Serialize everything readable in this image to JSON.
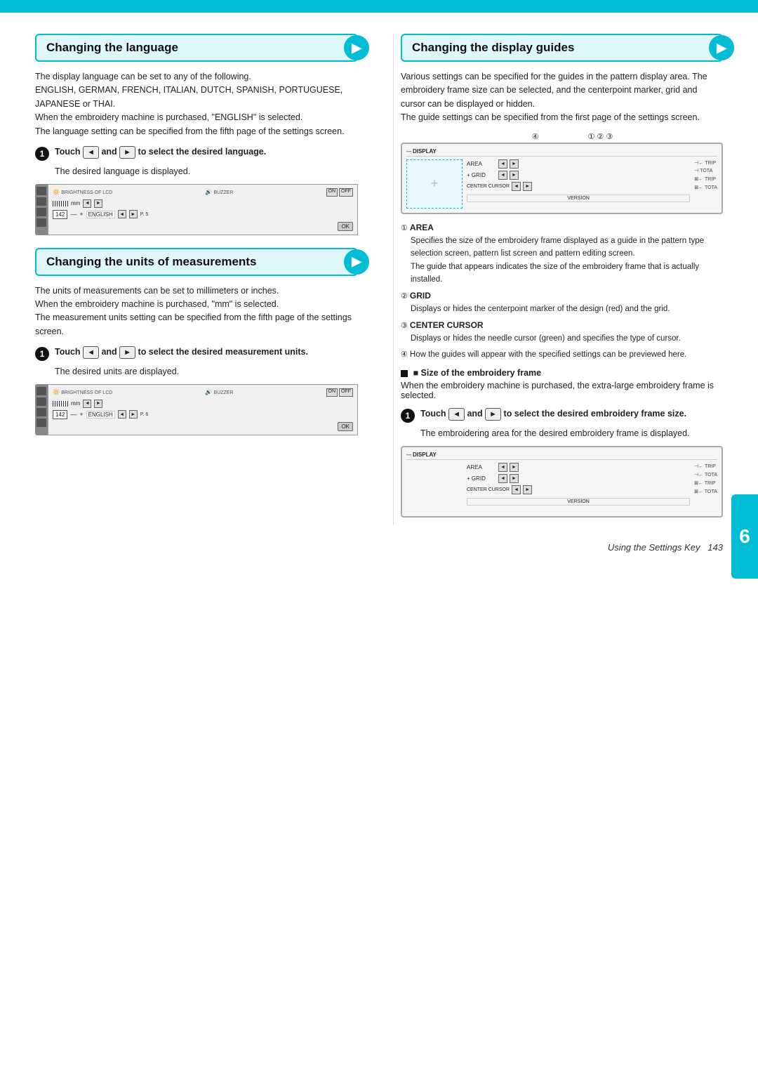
{
  "page": {
    "top_bar_color": "#00bcd4",
    "side_tab_number": "6",
    "footer_text": "Using the Settings Key",
    "footer_page": "143"
  },
  "left_column": {
    "section1": {
      "title": "Changing the language",
      "body_paragraphs": [
        "The display language can be set to any of the following.",
        "ENGLISH, GERMAN, FRENCH, ITALIAN, DUTCH, SPANISH, PORTUGUESE, JAPANESE or THAI.",
        "When the embroidery machine is purchased, \"ENGLISH\" is selected.",
        "The language setting can be specified from the fifth page of the settings screen."
      ],
      "step1": {
        "number": "1",
        "text_before": "Touch",
        "left_arrow": "◄",
        "and_text": "and",
        "right_arrow": "►",
        "text_after": "to select the desired language."
      },
      "result_text": "The desired language is displayed.",
      "screen": {
        "brightness_label": "BRIGHTNESS OF LCD",
        "buzzer_label": "BUZZER",
        "on_label": "ON",
        "off_label": "OFF",
        "mm_label": "mm",
        "num_value": "142",
        "english_label": "ENGLISH",
        "ok_label": "OK",
        "page_indicator": "P. 5"
      }
    },
    "section2": {
      "title": "Changing the units of measurements",
      "body_paragraphs": [
        "The units of measurements can be set to millimeters or inches.",
        "When the embroidery machine is purchased, \"mm\" is selected.",
        "The measurement units setting can be specified from the fifth page of the settings screen."
      ],
      "step1": {
        "number": "1",
        "text_before": "Touch",
        "left_arrow": "◄",
        "and_text": "and",
        "right_arrow": "►",
        "text_after": "to select the desired measurement units."
      },
      "result_text": "The desired units are displayed.",
      "screen": {
        "brightness_label": "BRIGHTNESS OF LCD",
        "buzzer_label": "BUZZER",
        "on_label": "ON",
        "off_label": "OFF",
        "mm_label": "mm",
        "num_value": "142",
        "english_label": "ENGLISH",
        "ok_label": "OK",
        "page_indicator": "P. 6"
      }
    }
  },
  "right_column": {
    "section1": {
      "title": "Changing the display guides",
      "body_paragraphs": [
        "Various settings can be specified for the guides in the pattern display area. The embroidery frame size can be selected, and the centerpoint marker, grid and cursor can be displayed or hidden.",
        "The guide settings can be specified from the first page of the settings screen."
      ],
      "callouts": [
        {
          "num": "①",
          "label": "①"
        },
        {
          "num": "②",
          "label": "②"
        },
        {
          "num": "③",
          "label": "③"
        },
        {
          "num": "④",
          "label": "④"
        }
      ],
      "screen": {
        "display_label": "DISPLAY",
        "area_label": "AREA",
        "grid_label": "+ GRID",
        "center_cursor_label": "CENTER CURSOR",
        "version_label": "VERSION",
        "right_info": [
          "⊣← TRIP",
          "⊣ TOTA",
          "⊠← TRIP",
          "⊠← TOTA"
        ]
      },
      "notes": [
        {
          "number": "①",
          "title": "AREA",
          "text": "Specifies the size of the embroidery frame displayed as a guide in the pattern type selection screen, pattern list screen and pattern editing screen.\nThe guide that appears indicates the size of the embroidery frame that is actually installed."
        },
        {
          "number": "②",
          "title": "GRID",
          "text": "Displays or hides the centerpoint marker of the design (red) and the grid."
        },
        {
          "number": "③",
          "title": "CENTER CURSOR",
          "text": "Displays or hides the needle cursor (green) and specifies the type of cursor."
        },
        {
          "number": "④",
          "text": "How the guides will appear with the specified settings can be previewed here."
        }
      ],
      "size_section": {
        "heading": "■ Size of the embroidery frame",
        "text": "When the embroidery machine is purchased, the extra-large embroidery frame is selected."
      },
      "step1": {
        "number": "1",
        "text_before": "Touch",
        "left_arrow": "◄",
        "and_text": "and",
        "right_arrow": "►",
        "text_after": "to select the desired embroidery frame size."
      },
      "result_text": "The embroidering area for the desired embroidery frame is displayed.",
      "screen2": {
        "display_label": "DISPLAY",
        "area_label": "AREA",
        "grid_label": "+ GRID",
        "center_cursor_label": "CENTER CURSOR",
        "version_label": "VERSION",
        "right_info_top": [
          "⊣← TRIP",
          "⊣← TOTA"
        ],
        "right_info_mid": [
          "⊠← TRIP",
          "⊠← TOTA"
        ]
      }
    }
  }
}
